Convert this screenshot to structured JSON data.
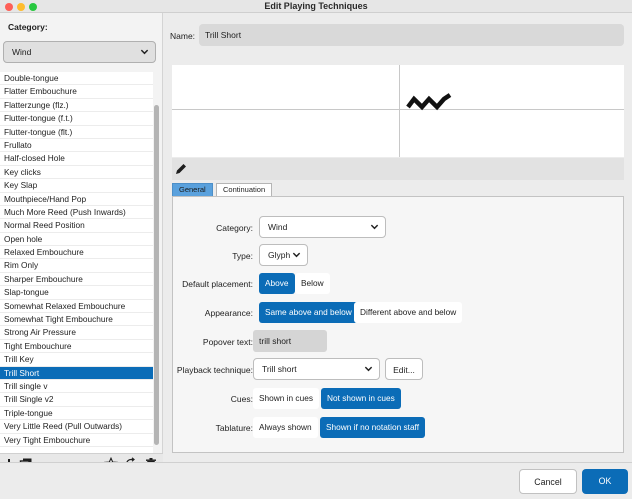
{
  "window": {
    "title": "Edit Playing Techniques"
  },
  "left": {
    "category_label": "Category:",
    "category_value": "Wind",
    "items": [
      "Double-tongue",
      "Flatter Embouchure",
      "Flatterzunge (flz.)",
      "Flutter-tongue (f.t.)",
      "Flutter-tongue (flt.)",
      "Frullato",
      "Half-closed Hole",
      "Key clicks",
      "Key Slap",
      "Mouthpiece/Hand Pop",
      "Much More Reed (Push Inwards)",
      "Normal Reed Position",
      "Open hole",
      "Relaxed Embouchure",
      "Rim Only",
      "Sharper Embouchure",
      "Slap-tongue",
      "Somewhat Relaxed Embouchure",
      "Somewhat Tight Embouchure",
      "Strong Air Pressure",
      "Tight Embouchure",
      "Trill Key",
      "Trill Short",
      "Trill single v",
      "Trill Single v2",
      "Triple-tongue",
      "Very Little Reed (Pull Outwards)",
      "Very Tight Embouchure"
    ]
  },
  "editor": {
    "name_label": "Name:",
    "name_value": "Trill Short",
    "tabs": [
      "General",
      "Continuation"
    ],
    "category_label": "Category:",
    "category_value": "Wind",
    "type_label": "Type:",
    "type_value": "Glyph",
    "default_placement_label": "Default placement:",
    "placement_options": [
      "Above",
      "Below"
    ],
    "appearance_label": "Appearance:",
    "appearance_options": [
      "Same above and below",
      "Different above and below"
    ],
    "popover_label": "Popover text:",
    "popover_value": "trill short",
    "playback_label": "Playback technique:",
    "playback_value": "Trill short",
    "playback_edit": "Edit...",
    "cues_label": "Cues:",
    "cues_options": [
      "Shown in cues",
      "Not shown in cues"
    ],
    "tablature_label": "Tablature:",
    "tablature_options": [
      "Always shown",
      "Shown if no notation staff"
    ]
  },
  "footer": {
    "cancel": "Cancel",
    "ok": "OK"
  },
  "colors": {
    "accent": "#0b6cb7",
    "tab_active": "#5aa1dd"
  }
}
